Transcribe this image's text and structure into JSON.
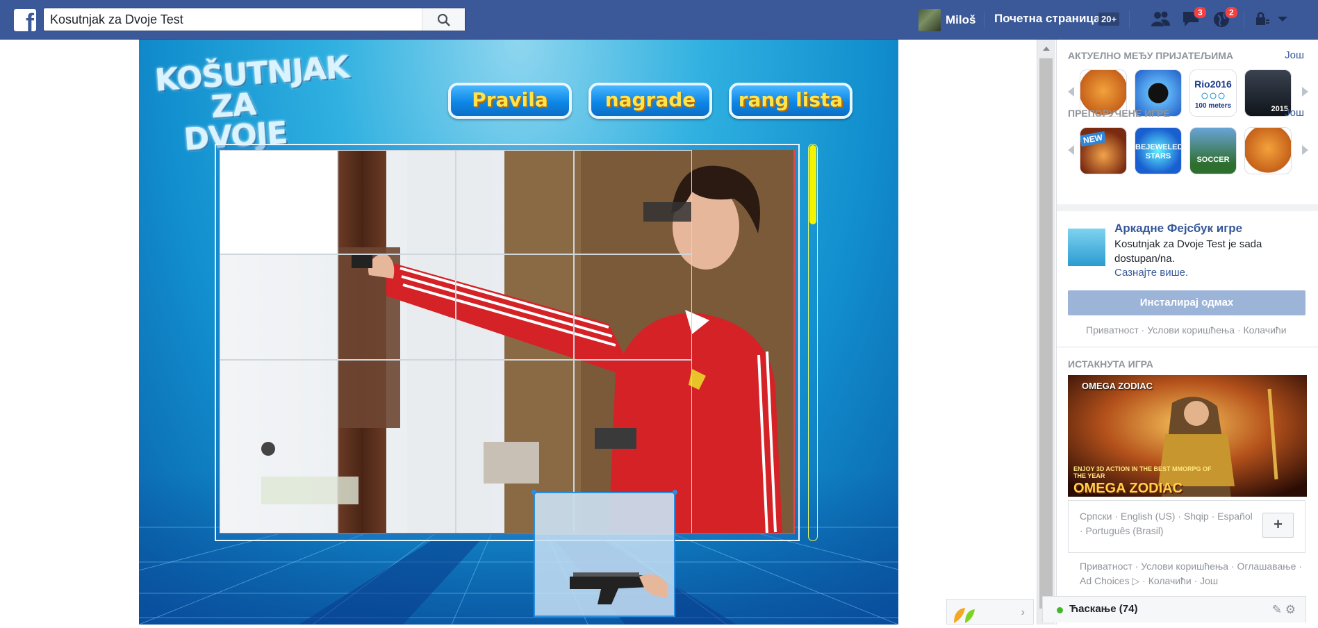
{
  "header": {
    "search_value": "Kosutnjak za Dvoje Test",
    "user_name": "Miloš",
    "home_label": "Почетна страница",
    "home_badge": "20+",
    "messages_badge": "3",
    "notifications_badge": "2"
  },
  "game": {
    "logo_line1": "KOŠUTNJAK",
    "logo_line2": "ZA DVOJE",
    "buttons": [
      "Pravila",
      "nagrade",
      "rang lista"
    ],
    "timer_fill_fraction": 0.2
  },
  "sidebar": {
    "trending_title": "АКТУЕЛНО МЕЂУ ПРИЈАТЕЉИМА",
    "trending_more": "Још",
    "trending_games": [
      "owl-game",
      "8-ball-pool",
      "Rio2016",
      "football-manager-2015"
    ],
    "trending_labels": {
      "rio_line1": "Rio2016",
      "rio_line2": "100 meters",
      "fm_year": "2015"
    },
    "recommended_title": "ПРЕПОРУЧЕНЕ ИГРЕ",
    "recommended_more": "Још",
    "recommended_new_badge": "NEW",
    "recommended_labels": {
      "bejeweled": "BEJEWELED STARS",
      "soccer": "SOCCER"
    },
    "promo_title": "Аркадне Фејсбук игре",
    "promo_text": "Kosutnjak za Dvoje Test je sada dostupan/na.",
    "promo_link": "Сазнајте више.",
    "install_button": "Инсталирај одмах",
    "links_1": "Приватност · Услови коришћења · Колачићи",
    "featured_title": "ИСТАКНУТА ИГРА",
    "featured_game_caption": "OMEGA ZODIAC",
    "featured_game_tagline": "ENJOY 3D ACTION IN THE BEST MMORPG OF THE YEAR",
    "languages": "Српски · English (US) · Shqip · Español · Português (Brasil)",
    "plus_label": "+",
    "footer": "Приватност · Услови коришћења · Оглашавање · Ad Choices ▷ · Колачићи · Још"
  },
  "chat": {
    "label": "Ћаскање (74)"
  },
  "colors": {
    "facebook_blue": "#3b5998",
    "install_button": "#9cb4d8",
    "timer_yellow": "#f4f400",
    "game_button_text": "#ffe34a"
  }
}
